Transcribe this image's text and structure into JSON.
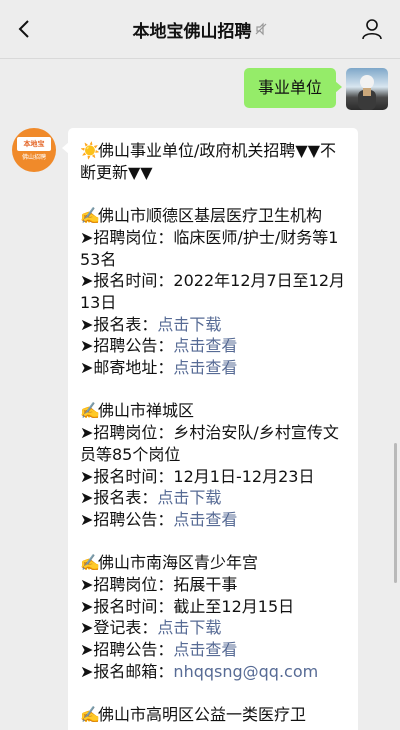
{
  "header": {
    "title": "本地宝佛山招聘",
    "back_icon": "back-arrow-icon",
    "mute_icon": "mute-icon",
    "contact_icon": "person-icon"
  },
  "outgoing": {
    "text": "事业单位"
  },
  "bot_avatar": {
    "logo_top": "本地宝",
    "logo_bottom": "佛山招聘"
  },
  "message": {
    "intro_emoji": "☀️",
    "intro": "佛山事业单位/政府机关招聘▼▼不断更新▼▼",
    "sections": [
      {
        "title_emoji": "✍️",
        "title": "佛山市顺德区基层医疗卫生机构",
        "lines": [
          {
            "prefix": "➤招聘岗位：",
            "value": "临床医师/护士/财务等153名",
            "link": ""
          },
          {
            "prefix": "➤报名时间：",
            "value": "2022年12月7日至12月13日",
            "link": ""
          },
          {
            "prefix": "➤报名表：",
            "value": "",
            "link": "点击下载"
          },
          {
            "prefix": "➤招聘公告：",
            "value": "",
            "link": "点击查看"
          },
          {
            "prefix": "➤邮寄地址：",
            "value": "",
            "link": "点击查看"
          }
        ]
      },
      {
        "title_emoji": "✍️",
        "title": "佛山市禅城区",
        "lines": [
          {
            "prefix": "➤招聘岗位：",
            "value": "乡村治安队/乡村宣传文员等85个岗位",
            "link": ""
          },
          {
            "prefix": "➤报名时间：",
            "value": "12月1日-12月23日",
            "link": ""
          },
          {
            "prefix": "➤报名表：",
            "value": "",
            "link": "点击下载"
          },
          {
            "prefix": "➤招聘公告：",
            "value": "",
            "link": "点击查看"
          }
        ]
      },
      {
        "title_emoji": "✍️",
        "title": "佛山市南海区青少年宫",
        "lines": [
          {
            "prefix": "➤招聘岗位：",
            "value": "拓展干事",
            "link": ""
          },
          {
            "prefix": "➤报名时间：",
            "value": "截止至12月15日",
            "link": ""
          },
          {
            "prefix": "➤登记表：",
            "value": "",
            "link": "点击下载"
          },
          {
            "prefix": "➤招聘公告：",
            "value": "",
            "link": "点击查看"
          },
          {
            "prefix": "➤报名邮箱：",
            "value": "",
            "link": "nhqqsng@qq.com"
          }
        ]
      },
      {
        "title_emoji": "✍️",
        "title": "佛山市高明区公益一类医疗卫",
        "lines": []
      }
    ]
  }
}
